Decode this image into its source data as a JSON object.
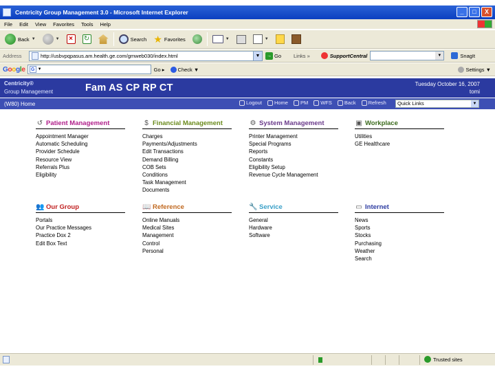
{
  "window": {
    "title": "Centricity Group Management 3.0 - Microsoft Internet Explorer",
    "buttons": [
      "_",
      "□",
      "X"
    ]
  },
  "menu": [
    "File",
    "Edit",
    "View",
    "Favorites",
    "Tools",
    "Help"
  ],
  "toolbar": {
    "back": "Back",
    "search": "Search",
    "favorites": "Favorites"
  },
  "address": {
    "label": "Address",
    "url": "http://usbvpqpasus.am.health.ge.com/gmweb030/index.html",
    "go": "Go",
    "links": "Links",
    "links_more": "»",
    "support": "SupportCentral",
    "snagit": "SnagIt"
  },
  "google": {
    "logo": [
      "G",
      "o",
      "o",
      "g",
      "l",
      "e"
    ],
    "go": "Go",
    "check": "Check",
    "settings": "Settings"
  },
  "app": {
    "brand_line1": "Centricity®",
    "brand_line2": "Group Management",
    "practice": "Fam AS CP RP CT",
    "date": "Tuesday October 16, 2007",
    "user": "tomi"
  },
  "nav": {
    "crumb": "(W80) Home",
    "links": [
      "Logout",
      "Home",
      "PM",
      "WFS",
      "Back",
      "Refresh"
    ],
    "quick_links": "Quick Links"
  },
  "sections": {
    "patient": {
      "title": "Patient Management",
      "items": [
        "Appointment Manager",
        "Automatic Scheduling",
        "Provider Schedule",
        "Resource View",
        "Referrals Plus",
        "Eligibility"
      ]
    },
    "financial": {
      "title": "Financial Management",
      "items": [
        "Charges",
        "Payments/Adjustments",
        "Edit Transactions",
        "Demand Billing",
        "COB Sets",
        "Conditions",
        "Task Management",
        "Documents"
      ]
    },
    "system": {
      "title": "System Management",
      "items": [
        "Printer Management",
        "Special Programs",
        "Reports",
        "Constants",
        "Eligibility Setup",
        "Revenue Cycle Management"
      ]
    },
    "workplace": {
      "title": "Workplace",
      "items": [
        "Utilities",
        "GE Healthcare"
      ]
    },
    "group": {
      "title": "Our Group",
      "items": [
        "Portals",
        "Our Practice Messages",
        "Practice Dox 2",
        "Edit Box Text"
      ]
    },
    "reference": {
      "title": "Reference",
      "items": [
        "Online Manuals",
        "Medical Sites",
        "Management",
        "Control",
        "Personal"
      ]
    },
    "service": {
      "title": "Service",
      "items": [
        "General",
        "Hardware",
        "Software"
      ]
    },
    "internet": {
      "title": "Internet",
      "items": [
        "News",
        "Sports",
        "Stocks",
        "Purchasing",
        "Weather",
        "Search"
      ]
    }
  },
  "status": {
    "zone": "Trusted sites"
  },
  "colors": {
    "header_bg": "#2b3aa0",
    "nav_bg": "#3d4fb4",
    "patient_title": "#b01f8a",
    "financial_title": "#6a8a1c",
    "system_title": "#6a3a8a",
    "workplace_title": "#3a6a1c",
    "group_title": "#c01f1f",
    "reference_title": "#c0681f",
    "service_title": "#3aa0c8",
    "internet_title": "#2b3aa0"
  }
}
